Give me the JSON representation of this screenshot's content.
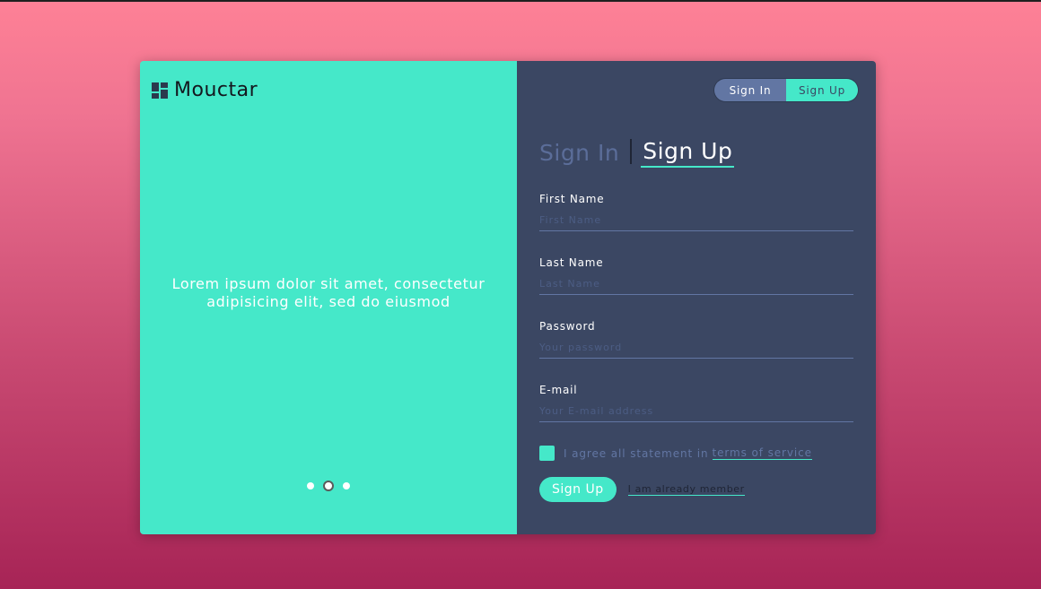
{
  "brand": {
    "name": "Mouctar",
    "icon": "dashboard-grid-icon"
  },
  "hero": {
    "tagline": "Lorem ipsum dolor sit amet, consectetur adipisicing elit, sed do eiusmod",
    "carousel": {
      "count": 3,
      "active_index": 1
    }
  },
  "switcher": {
    "signin_label": "Sign In",
    "signup_label": "Sign Up",
    "active": "Sign Up"
  },
  "tabs": {
    "signin_label": "Sign In",
    "signup_label": "Sign Up",
    "active": "Sign Up"
  },
  "form": {
    "first_name": {
      "label": "First Name",
      "placeholder": "First Name",
      "value": ""
    },
    "last_name": {
      "label": "Last Name",
      "placeholder": "Last Name",
      "value": ""
    },
    "password": {
      "label": "Password",
      "placeholder": "Your password",
      "value": ""
    },
    "email": {
      "label": "E-mail",
      "placeholder": "Your E-mail address",
      "value": ""
    },
    "agree_text": "I agree all statement in",
    "terms_link": "terms of service",
    "submit_label": "Sign Up",
    "member_link": "I am already member"
  },
  "colors": {
    "accent": "#45e8c9",
    "panel": "#3b4763",
    "muted": "#6276a3",
    "background_top": "#fe8196",
    "background_bottom": "#a72456"
  }
}
